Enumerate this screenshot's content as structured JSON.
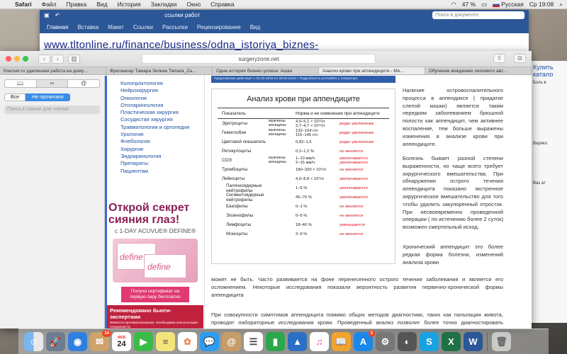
{
  "menubar": {
    "app": "Safari",
    "items": [
      "Файл",
      "Правка",
      "Вид",
      "История",
      "Закладки",
      "Окно",
      "Справка"
    ],
    "battery": "47 %",
    "language": "Русская",
    "clock": "Ср 19:08"
  },
  "word": {
    "title": "ссылки работ",
    "search_placeholder": "Поиск в документе",
    "ribbon": [
      "Главная",
      "Вставка",
      "Макет",
      "Ссылки",
      "Рассылки",
      "Рецензирование",
      "Вид"
    ],
    "url_text": "www.tltonline.ru/finance/business/odna_istoriya_biznes-"
  },
  "safari": {
    "address": "surgeryzone.net",
    "tabs": [
      "fnlanser.ru удаленная работа на дому...",
      "Фрилансер Тамара Зелкан Tamara_Za...",
      "Одна история бизнес-успеха: Ашан",
      "Анализ крови при аппендиците - Ме...",
      "Обучение вождению легкового авт..."
    ],
    "sidebar": {
      "segments": [
        "book",
        "glasses",
        "@"
      ],
      "filter_all": "Все",
      "filter_unread": "Не прочитано",
      "search_placeholder": "Поиск в списке для чтения"
    }
  },
  "site": {
    "categories": [
      "Колопроктология",
      "Нейрохирургия",
      "Онкология",
      "Отоларингология",
      "Пластическая хирургия",
      "Сосудистая хирургия",
      "Травматология и ортопедия",
      "Урология",
      "Флебология",
      "Хирургия",
      "Эндокринология",
      "Препараты",
      "Пациентам"
    ],
    "ad": {
      "headline": "Открой секрет сияния глаз!",
      "subline": "с 1-DAY ACUVUE® DEFINE®",
      "product_name": "define",
      "cta": "Получи сертификат на первую пару бесплатно",
      "banner_title": "Рекомендовано бьюти-экспертами",
      "banner_fine": "Имеются противопоказания. Необходима консультация специалиста."
    },
    "date_bar": "Предложение действует с 01.02.2016 по 29.02.2016 г. Подробности уточняйте у оператора.",
    "table": {
      "title": "Анализ крови при аппендиците",
      "header": {
        "indicator": "Показатель",
        "norm": "Норма и ее изменение при аппендиците"
      },
      "rows": [
        {
          "name": "Эритроциты",
          "sex": "мужчины\nженщины",
          "norm": "4,0–5,1 × 10¹²/л\n3,7–4,7 × 10¹²/л",
          "change": "редко увеличение"
        },
        {
          "name": "Гемоглобин",
          "sex": "мужчины\nженщины",
          "norm": "132–164 г/л\n115–145 г/л",
          "change": "редко увеличение"
        },
        {
          "name": "Цветовой показатель",
          "sex": "",
          "norm": "0,82–1,5",
          "change": "редко увеличение"
        },
        {
          "name": "Ретикулоциты",
          "sex": "",
          "norm": "0,2–1,2 %",
          "change": "не меняется"
        },
        {
          "name": "СОЭ",
          "sex": "мужчины\nженщины",
          "norm": "1–10 мм/ч\n2–15 мм/ч",
          "change": "увеличивается\nувеличивается"
        },
        {
          "name": "Тромбоциты",
          "sex": "",
          "norm": "180–320 × 10⁹/л",
          "change": "не меняется"
        },
        {
          "name": "Лейкоциты",
          "sex": "",
          "norm": "4,0–8,8 × 10⁹/л",
          "change": "увеличивается"
        },
        {
          "name": "Палочкоядерные нейтрофилы",
          "sex": "",
          "norm": "1–6 %",
          "change": "увеличивается",
          "sub": true
        },
        {
          "name": "Сегментоядерные нейтрофилы",
          "sex": "",
          "norm": "45–70 %",
          "change": "увеличивается",
          "sub": true
        },
        {
          "name": "Базофилы",
          "sex": "",
          "norm": "0–1 %",
          "change": "не меняется",
          "sub": true
        },
        {
          "name": "Эозинофилы",
          "sex": "",
          "norm": "0–5 %",
          "change": "не меняется",
          "sub": true
        },
        {
          "name": "Лимфоциты",
          "sex": "",
          "norm": "18–40 %",
          "change": "уменьшается",
          "sub": true
        },
        {
          "name": "Моноциты",
          "sex": "",
          "norm": "2–9 %",
          "change": "не меняется",
          "sub": true
        }
      ]
    },
    "article": {
      "p1": "Наличие островоспалительного процесса в аппендиксе ( придатке слепой кишки) является таким нередким заболеванием брюшной полости как аппендицит, чем активнее воспаление, тем больше выражены изменения в анализе крови при аппендиците.",
      "p2": "Болезнь бывает разной степени выраженности, но чаще всего требует хирургического вмешательства. При обнаружении острого течения аппендицита показано экстренное хирургическое вмешательство для того чтобы удалить закупоренный отросток. При несвоевременно проведенной операции ( по истечению более 2 суток) возможен смертельный исход.",
      "p3": "Хронический аппендицит это более редкая форма болезни, изменений анализа крови",
      "p4": "может не быть. Часто развивается на фоне перенесенного острого течения заболевания и является его осложнением. Некоторые исследования показали вероятность развития первично-хронической формы аппендицита",
      "p5": "При совокупности симптомов аппендицита помимо общих методов диагностики, таких как пальпация живота, проводят лабораторные исследования крови. Проведенный анализ позволит более точно диагностировать аппендицит."
    }
  },
  "background_window": {
    "link_text": "Кулить катало",
    "lines": [
      "Боль в",
      "Варико",
      "Ваз ат"
    ]
  },
  "dock": {
    "icons": [
      "finder-icon",
      "launchpad-icon",
      "safari-icon",
      "mail-icon",
      "calendar-icon",
      "facetime-icon",
      "notes-icon",
      "photos-icon",
      "messages-icon",
      "contacts-icon",
      "reminders-icon",
      "numbers-icon",
      "keynote-icon",
      "itunes-icon",
      "ibooks-icon",
      "appstore-icon",
      "preferences-icon",
      "browser-icon",
      "skype-icon",
      "excel-icon",
      "word-icon",
      "trash-icon"
    ],
    "mail_badge": "14",
    "calendar_day": "24",
    "calendar_month": "ФЕВ",
    "appstore_badge": "3"
  },
  "colors": {
    "accent": "#3a8ee6",
    "brand_word": "#2b5797",
    "warning_red": "#e0121b"
  }
}
